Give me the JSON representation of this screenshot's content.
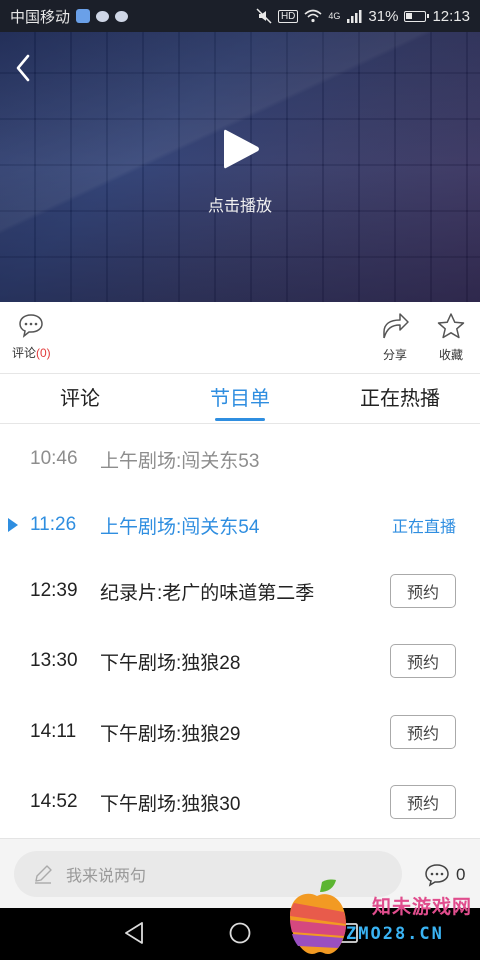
{
  "status_bar": {
    "carrier": "中国移动",
    "network": "4G",
    "battery": "31%",
    "time": "12:13",
    "hd": "HD"
  },
  "player": {
    "play_label": "点击播放"
  },
  "actions": {
    "comment_label": "评论",
    "comment_count": "(0)",
    "share_label": "分享",
    "favorite_label": "收藏"
  },
  "tabs": [
    {
      "label": "评论"
    },
    {
      "label": "节目单"
    },
    {
      "label": "正在热播"
    }
  ],
  "schedule": [
    {
      "time": "10:46",
      "title": "上午剧场:闯关东53",
      "state": "past"
    },
    {
      "time": "11:26",
      "title": "上午剧场:闯关东54",
      "state": "live",
      "status_label": "正在直播"
    },
    {
      "time": "12:39",
      "title": "纪录片:老广的味道第二季",
      "state": "upcoming",
      "button_label": "预约"
    },
    {
      "time": "13:30",
      "title": "下午剧场:独狼28",
      "state": "upcoming",
      "button_label": "预约"
    },
    {
      "time": "14:11",
      "title": "下午剧场:独狼29",
      "state": "upcoming",
      "button_label": "预约"
    },
    {
      "time": "14:52",
      "title": "下午剧场:独狼30",
      "state": "upcoming",
      "button_label": "预约"
    }
  ],
  "comment_bar": {
    "placeholder": "我来说两句",
    "count": "0"
  },
  "watermark": {
    "cn": "知未游戏网",
    "en": "ZMO28.CN"
  },
  "colors": {
    "accent": "#2f8ee0",
    "red": "#e23b3b"
  }
}
